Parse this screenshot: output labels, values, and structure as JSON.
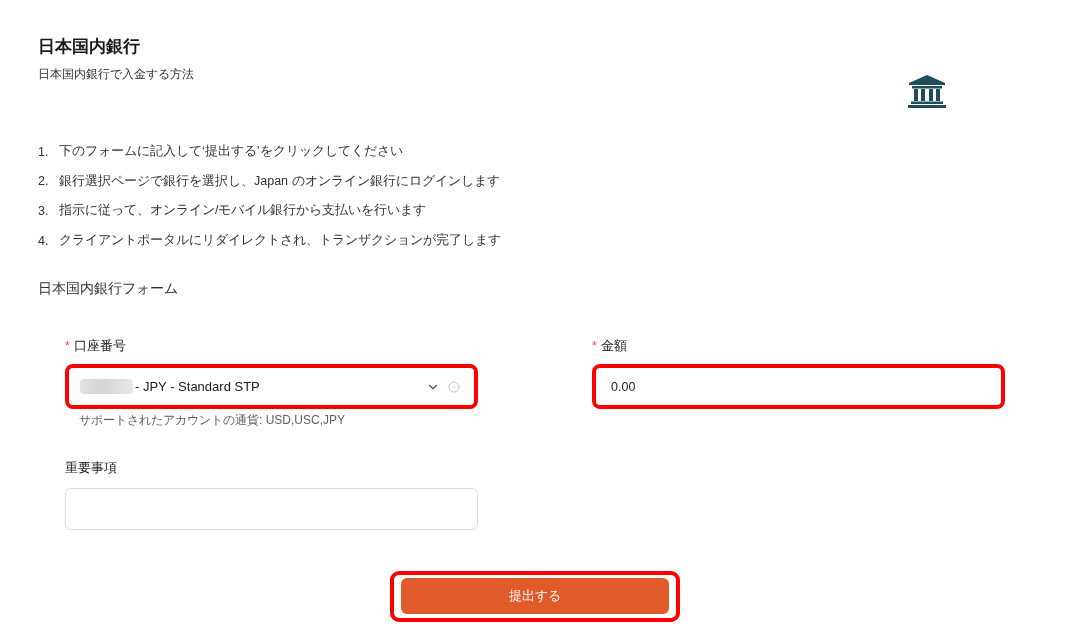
{
  "header": {
    "title": "日本国内銀行",
    "subtitle": "日本国内銀行で入金する方法"
  },
  "steps": [
    {
      "number": "1.",
      "text": "下のフォームに記入して‘提出する’をクリックしてください"
    },
    {
      "number": "2.",
      "text": "銀行選択ページで銀行を選択し、Japan のオンライン銀行にログインします"
    },
    {
      "number": "3.",
      "text": "指示に従って、オンライン/モバイル銀行から支払いを行います"
    },
    {
      "number": "4.",
      "text": "クライアントポータルにリダイレクトされ、トランザクションが完了します"
    }
  ],
  "form": {
    "title": "日本国内銀行フォーム",
    "fields": [
      {
        "kind": "select",
        "required_mark": "*",
        "label": "口座番号",
        "redacted": true,
        "value": "- JPY - Standard STP",
        "help": "サポートされたアカウントの通貨: USD,USC,JPY",
        "highlighted": true
      },
      {
        "kind": "input",
        "required_mark": "*",
        "label": "金額",
        "value": "0.00",
        "highlighted": true
      },
      {
        "kind": "textarea",
        "label": "重要事項",
        "highlighted": false
      }
    ],
    "submit": {
      "label": "提出する",
      "highlighted": true
    }
  }
}
